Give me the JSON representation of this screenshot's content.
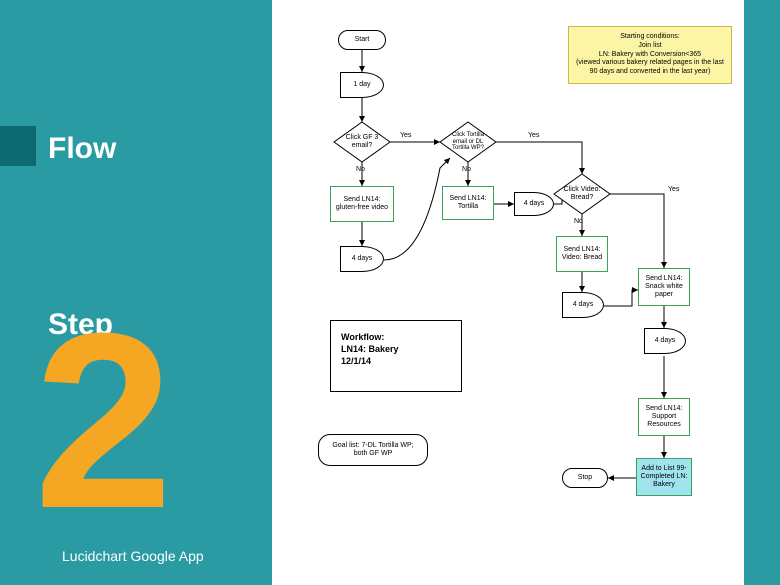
{
  "left": {
    "flow": "Flow",
    "step": "Step",
    "big_number": "2",
    "app": "Lucidchart Google App"
  },
  "note": {
    "l1": "Starting conditions:",
    "l2": "Join list",
    "l3": "LN: Bakery with Conversion<365",
    "l4": "(viewed various bakery related pages in the last",
    "l5": "90 days and converted in the last year)"
  },
  "workflow": {
    "l1": "Workflow:",
    "l2": "LN14: Bakery",
    "l3": "12/1/14"
  },
  "goal": "Goal list: 7-DL Tortilla WP; both GF WP",
  "nodes": {
    "start": "Start",
    "delay1": "1 day",
    "dec_gf": "Click GF 3 email?",
    "send_gf_video": "Send LN14: gluten-free video",
    "delay_gf4": "4 days",
    "dec_tortilla": "Click Tortilla email or DL Tortilla WP?",
    "send_tortilla": "Send LN14: Tortilla",
    "delay_tort4": "4 days",
    "dec_bread": "Click Video: Bread?",
    "send_bread": "Send LN14: Video: Bread",
    "delay_bread4": "4 days",
    "send_snack": "Send LN14: Snack white paper",
    "delay_snack4": "4 days",
    "send_support": "Send LN14: Support Resources",
    "add_list": "Add to List 99-Completed LN: Bakery",
    "stop": "Stop"
  },
  "labels": {
    "yes": "Yes",
    "no": "No"
  },
  "chart_data": {
    "type": "flowchart",
    "title": "Workflow: LN14: Bakery 12/1/14",
    "starting_conditions": "Join list LN: Bakery with Conversion<365 (viewed various bakery related pages in the last 90 days and converted in the last year)",
    "goal": "Goal list: 7-DL Tortilla WP; both GF WP",
    "nodes": [
      {
        "id": "start",
        "type": "terminator",
        "text": "Start"
      },
      {
        "id": "delay1",
        "type": "delay",
        "text": "1 day"
      },
      {
        "id": "dec_gf",
        "type": "decision",
        "text": "Click GF 3 email?"
      },
      {
        "id": "send_gf_video",
        "type": "process",
        "text": "Send LN14: gluten-free video"
      },
      {
        "id": "delay_gf4",
        "type": "delay",
        "text": "4 days"
      },
      {
        "id": "dec_tortilla",
        "type": "decision",
        "text": "Click Tortilla email or DL Tortilla WP?"
      },
      {
        "id": "send_tortilla",
        "type": "process",
        "text": "Send LN14: Tortilla"
      },
      {
        "id": "delay_tort4",
        "type": "delay",
        "text": "4 days"
      },
      {
        "id": "dec_bread",
        "type": "decision",
        "text": "Click Video: Bread?"
      },
      {
        "id": "send_bread",
        "type": "process",
        "text": "Send LN14: Video: Bread"
      },
      {
        "id": "delay_bread4",
        "type": "delay",
        "text": "4 days"
      },
      {
        "id": "send_snack",
        "type": "process",
        "text": "Send LN14: Snack white paper"
      },
      {
        "id": "delay_snack4",
        "type": "delay",
        "text": "4 days"
      },
      {
        "id": "send_support",
        "type": "process",
        "text": "Send LN14: Support Resources"
      },
      {
        "id": "add_list",
        "type": "process",
        "text": "Add to List 99-Completed LN: Bakery"
      },
      {
        "id": "stop",
        "type": "terminator",
        "text": "Stop"
      }
    ],
    "edges": [
      {
        "from": "start",
        "to": "delay1"
      },
      {
        "from": "delay1",
        "to": "dec_gf"
      },
      {
        "from": "dec_gf",
        "to": "send_gf_video",
        "label": "No"
      },
      {
        "from": "dec_gf",
        "to": "dec_tortilla",
        "label": "Yes"
      },
      {
        "from": "send_gf_video",
        "to": "delay_gf4"
      },
      {
        "from": "delay_gf4",
        "to": "dec_tortilla"
      },
      {
        "from": "dec_tortilla",
        "to": "send_tortilla",
        "label": "No"
      },
      {
        "from": "dec_tortilla",
        "to": "dec_bread",
        "label": "Yes"
      },
      {
        "from": "send_tortilla",
        "to": "delay_tort4"
      },
      {
        "from": "delay_tort4",
        "to": "dec_bread"
      },
      {
        "from": "dec_bread",
        "to": "send_bread",
        "label": "No"
      },
      {
        "from": "dec_bread",
        "to": "send_snack",
        "label": "Yes"
      },
      {
        "from": "send_bread",
        "to": "delay_bread4"
      },
      {
        "from": "delay_bread4",
        "to": "send_snack"
      },
      {
        "from": "send_snack",
        "to": "delay_snack4"
      },
      {
        "from": "delay_snack4",
        "to": "send_support"
      },
      {
        "from": "send_support",
        "to": "add_list"
      },
      {
        "from": "add_list",
        "to": "stop"
      }
    ]
  }
}
